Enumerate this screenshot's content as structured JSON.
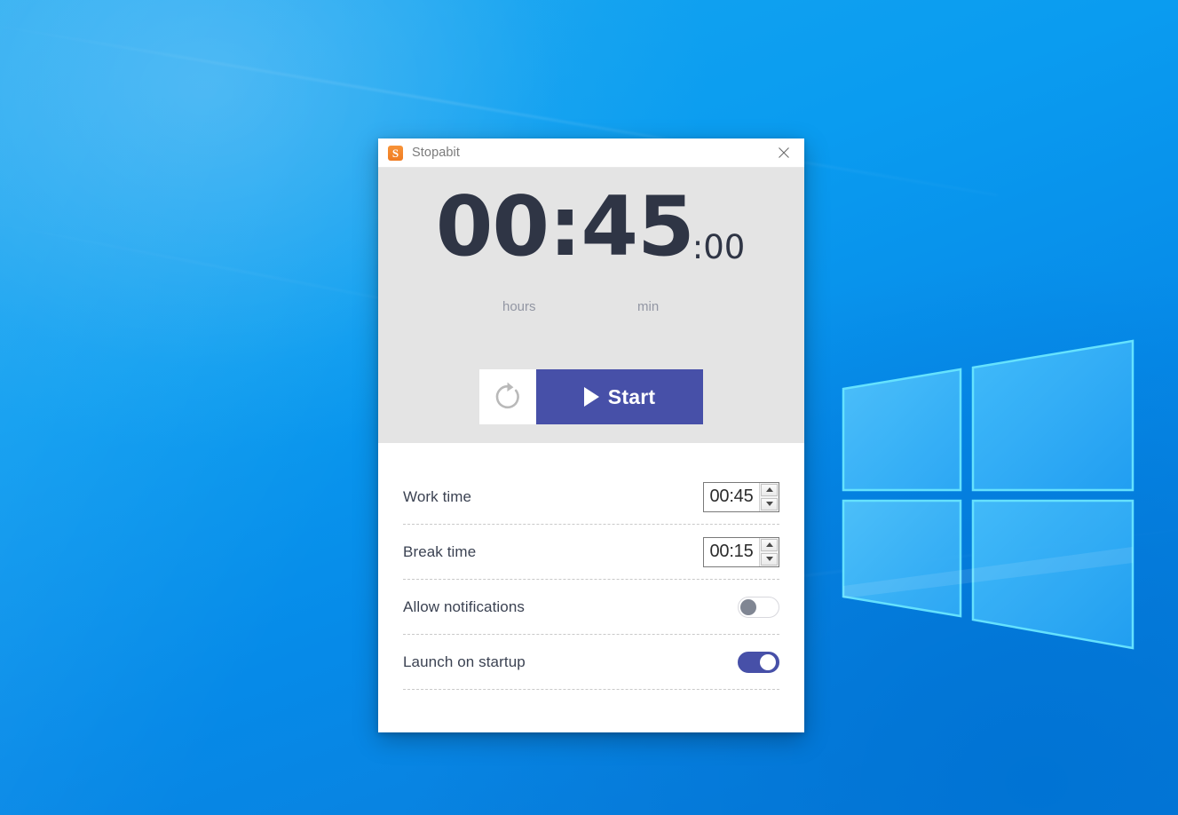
{
  "desktop": {
    "wallpaper_name": "windows-10-hero-wallpaper",
    "logo_name": "windows-logo",
    "accent_blue": "#0a9cf0"
  },
  "window": {
    "titlebar": {
      "app_icon_glyph": "S",
      "app_icon_name": "stopabit-app-icon",
      "app_icon_color": "#f07c22",
      "title": "Stopabit",
      "close_label": "✕"
    },
    "timer": {
      "main": "00:45",
      "seconds": ":00",
      "unit_hours": "hours",
      "unit_min": "min",
      "text_color": "#2f3545",
      "panel_bg": "#e4e4e4"
    },
    "controls": {
      "reset_icon_name": "refresh-icon",
      "start_label": "Start",
      "start_color": "#4750a8",
      "play_icon_name": "play-icon"
    },
    "settings": {
      "rows": [
        {
          "label": "Work time",
          "type": "spinner",
          "value": "00:45"
        },
        {
          "label": "Break time",
          "type": "spinner",
          "value": "00:15"
        },
        {
          "label": "Allow notifications",
          "type": "toggle",
          "state": "off"
        },
        {
          "label": "Launch on startup",
          "type": "toggle",
          "state": "on"
        }
      ]
    }
  }
}
